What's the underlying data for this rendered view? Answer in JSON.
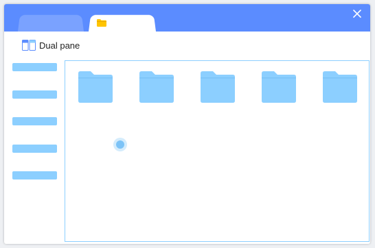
{
  "window": {
    "tabs": [
      {
        "label": "",
        "icon": "folder-icon",
        "active": false
      },
      {
        "label": "",
        "icon": "folder-icon",
        "active": true
      }
    ],
    "close_icon": "close-icon"
  },
  "toolbar": {
    "dual_pane_label": "Dual pane",
    "dual_pane_icon": "dual-pane-icon"
  },
  "sidebar": {
    "items": [
      "",
      "",
      "",
      "",
      ""
    ]
  },
  "content": {
    "folders": [
      "",
      "",
      "",
      "",
      ""
    ]
  },
  "colors": {
    "titlebar": "#5b8cff",
    "inactive_tab": "#7aa2ff",
    "accent_light": "#8ccfff",
    "tab_folder": "#ffc400"
  }
}
